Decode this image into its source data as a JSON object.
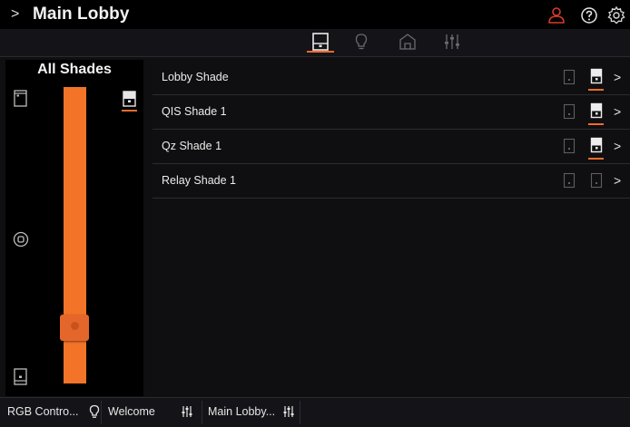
{
  "header": {
    "title": "Main Lobby",
    "chevron": ">",
    "icons": [
      "user-icon",
      "help-icon",
      "gear-icon"
    ],
    "user_icon_color": "#d93a2b"
  },
  "tabs": {
    "items": [
      "shades-tab",
      "lights-tab",
      "scenes-tab",
      "controls-tab"
    ],
    "selected": "shades-tab",
    "accent": "#f26b2b"
  },
  "all_shades": {
    "title": "All Shades",
    "slider_level_percent": 9,
    "slider_color": "#f37429"
  },
  "shades": [
    {
      "name": "Lobby Shade",
      "chevron": ">"
    },
    {
      "name": "QIS Shade 1",
      "chevron": ">"
    },
    {
      "name": "Qz Shade 1",
      "chevron": ">"
    },
    {
      "name": "Relay Shade 1",
      "chevron": ">"
    }
  ],
  "footer": {
    "tabs": [
      {
        "label": "RGB Contro...",
        "icon": "bulb-icon"
      },
      {
        "label": "Welcome",
        "icon": "sliders-icon"
      },
      {
        "label": "Main Lobby...",
        "icon": "sliders-icon"
      }
    ]
  }
}
